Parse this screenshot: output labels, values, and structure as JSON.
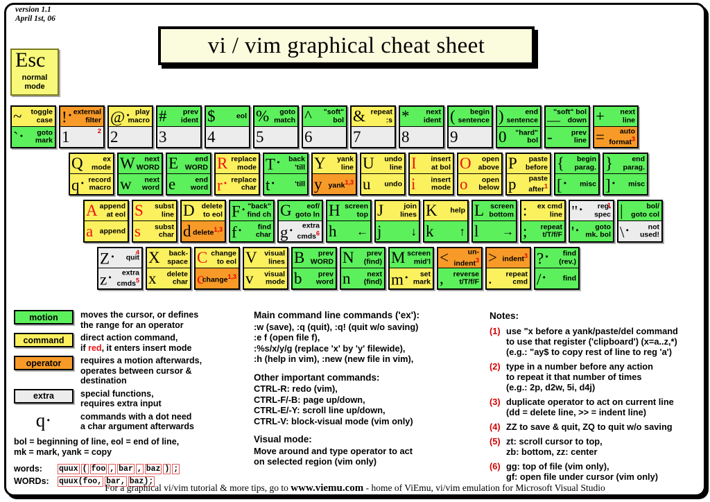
{
  "meta": {
    "version_line1": "version 1.1",
    "version_line2": "April 1st, 06",
    "title": "vi / vim graphical cheat sheet"
  },
  "esc_key": {
    "label": "Esc",
    "sub1": "normal",
    "sub2": "mode"
  },
  "colors": {
    "motion": "#5cf05c",
    "command": "#fbf05e",
    "operator": "#f79a28",
    "extra": "#ececec",
    "red_accent": "#ee1111",
    "title_bg": "#fbfbdd",
    "esc_bg": "#f8f87a"
  },
  "keyboard": {
    "rows": [
      {
        "name": "number-row",
        "indent": 15,
        "keys": [
          {
            "top": {
              "cap": "~",
              "mode": "command",
              "desc": "toggle\ncase"
            },
            "bottom": {
              "cap": "`",
              "dot": true,
              "mode": "motion",
              "desc": "goto\nmark"
            }
          },
          {
            "top": {
              "cap": "!",
              "dot": true,
              "mode": "operator",
              "desc": "external\nfilter"
            },
            "bottom": {
              "cap": "1",
              "mode": "extra",
              "desc": "",
              "sup": "2"
            }
          },
          {
            "top": {
              "cap": "@",
              "dot": true,
              "mode": "command",
              "desc": "play\nmacro"
            },
            "bottom": {
              "cap": "2",
              "mode": "extra",
              "desc": ""
            }
          },
          {
            "top": {
              "cap": "#",
              "mode": "motion",
              "desc": "prev\nident"
            },
            "bottom": {
              "cap": "3",
              "mode": "extra",
              "desc": ""
            }
          },
          {
            "top": {
              "cap": "$",
              "mode": "motion",
              "desc": "eol"
            },
            "bottom": {
              "cap": "4",
              "mode": "extra",
              "desc": ""
            }
          },
          {
            "top": {
              "cap": "%",
              "mode": "motion",
              "desc": "goto\nmatch"
            },
            "bottom": {
              "cap": "5",
              "mode": "extra",
              "desc": ""
            }
          },
          {
            "top": {
              "cap": "^",
              "mode": "motion",
              "desc": "\"soft\"\nbol"
            },
            "bottom": {
              "cap": "6",
              "mode": "extra",
              "desc": ""
            }
          },
          {
            "top": {
              "cap": "&",
              "mode": "command",
              "desc": "repeat\n:s"
            },
            "bottom": {
              "cap": "7",
              "mode": "extra",
              "desc": ""
            }
          },
          {
            "top": {
              "cap": "*",
              "mode": "motion",
              "desc": "next\nident"
            },
            "bottom": {
              "cap": "8",
              "mode": "extra",
              "desc": ""
            }
          },
          {
            "top": {
              "cap": "(",
              "mode": "motion",
              "desc": "begin\nsentence"
            },
            "bottom": {
              "cap": "9",
              "mode": "extra",
              "desc": ""
            }
          },
          {
            "top": {
              "cap": ")",
              "mode": "motion",
              "desc": "end\nsentence"
            },
            "bottom": {
              "cap": "0",
              "mode": "motion",
              "desc": "\"hard\"\nbol"
            }
          },
          {
            "top": {
              "cap": "__",
              "mode": "motion",
              "desc": "\"soft\" bol\ndown",
              "capsmall": true
            },
            "bottom": {
              "cap": "-",
              "mode": "motion",
              "desc": "prev\nline"
            }
          },
          {
            "top": {
              "cap": "+",
              "mode": "motion",
              "desc": "next\nline"
            },
            "bottom": {
              "cap": "=",
              "mode": "operator",
              "desc": "auto\nformat",
              "supin": "3"
            }
          }
        ]
      },
      {
        "name": "q-row",
        "indent": 99,
        "keys": [
          {
            "top": {
              "cap": "Q",
              "mode": "command",
              "desc": "ex\nmode"
            },
            "bottom": {
              "cap": "q",
              "dot": true,
              "mode": "command",
              "desc": "record\nmacro"
            }
          },
          {
            "top": {
              "cap": "W",
              "mode": "motion",
              "desc": "next\nWORD"
            },
            "bottom": {
              "cap": "w",
              "mode": "motion",
              "desc": "next\nword"
            }
          },
          {
            "top": {
              "cap": "E",
              "mode": "motion",
              "desc": "end\nWORD"
            },
            "bottom": {
              "cap": "e",
              "mode": "motion",
              "desc": "end\nword"
            }
          },
          {
            "top": {
              "cap": "R",
              "mode": "command",
              "red": true,
              "desc": "replace\nmode"
            },
            "bottom": {
              "cap": "r",
              "dot": true,
              "mode": "command",
              "red": true,
              "desc": "replace\nchar"
            }
          },
          {
            "top": {
              "cap": "T",
              "dot": true,
              "mode": "motion",
              "desc": "back\n'till"
            },
            "bottom": {
              "cap": "t",
              "dot": true,
              "mode": "motion",
              "desc": "'till"
            }
          },
          {
            "top": {
              "cap": "Y",
              "mode": "command",
              "desc": "yank\nline"
            },
            "bottom": {
              "cap": "y",
              "mode": "operator",
              "desc": "yank",
              "supin": "1,3"
            }
          },
          {
            "top": {
              "cap": "U",
              "mode": "command",
              "desc": "undo\nline"
            },
            "bottom": {
              "cap": "u",
              "mode": "command",
              "desc": "undo"
            }
          },
          {
            "top": {
              "cap": "I",
              "mode": "command",
              "red": true,
              "desc": "insert\nat bol"
            },
            "bottom": {
              "cap": "i",
              "mode": "command",
              "red": true,
              "desc": "insert\nmode"
            }
          },
          {
            "top": {
              "cap": "O",
              "mode": "command",
              "red": true,
              "desc": "open\nabove"
            },
            "bottom": {
              "cap": "o",
              "mode": "command",
              "red": true,
              "desc": "open\nbelow"
            }
          },
          {
            "top": {
              "cap": "P",
              "mode": "command",
              "desc": "paste\nbefore"
            },
            "bottom": {
              "cap": "p",
              "mode": "command",
              "desc": "paste\nafter",
              "supin": "1"
            }
          },
          {
            "top": {
              "cap": "{",
              "mode": "motion",
              "desc": "begin\nparag."
            },
            "bottom": {
              "cap": "[",
              "dot": true,
              "mode": "motion",
              "desc": "misc"
            }
          },
          {
            "top": {
              "cap": "}",
              "mode": "motion",
              "desc": "end\nparag."
            },
            "bottom": {
              "cap": "]",
              "dot": true,
              "mode": "motion",
              "desc": "misc"
            }
          }
        ]
      },
      {
        "name": "a-row",
        "indent": 120,
        "keys": [
          {
            "top": {
              "cap": "A",
              "mode": "command",
              "red": true,
              "desc": "append\nat eol"
            },
            "bottom": {
              "cap": "a",
              "mode": "command",
              "red": true,
              "desc": "append"
            }
          },
          {
            "top": {
              "cap": "S",
              "mode": "command",
              "red": true,
              "desc": "subst\nline"
            },
            "bottom": {
              "cap": "s",
              "mode": "command",
              "red": true,
              "desc": "subst\nchar"
            }
          },
          {
            "top": {
              "cap": "D",
              "mode": "command",
              "desc": "delete\nto eol"
            },
            "bottom": {
              "cap": "d",
              "mode": "operator",
              "desc": "delete",
              "supin": "1,3"
            }
          },
          {
            "top": {
              "cap": "F",
              "dot": true,
              "mode": "motion",
              "desc": "\"back\"\nfind ch"
            },
            "bottom": {
              "cap": "f",
              "dot": true,
              "mode": "motion",
              "desc": "find\nchar"
            }
          },
          {
            "top": {
              "cap": "G",
              "mode": "motion",
              "desc": "eof/\ngoto ln"
            },
            "bottom": {
              "cap": "g",
              "dot": true,
              "mode": "extra",
              "desc": "extra\ncmds",
              "supin": "6"
            }
          },
          {
            "top": {
              "cap": "H",
              "mode": "motion",
              "desc": "screen\ntop"
            },
            "bottom": {
              "cap": "h",
              "mode": "motion",
              "desc": "←",
              "arrow": true
            }
          },
          {
            "top": {
              "cap": "J",
              "mode": "command",
              "desc": "join\nlines"
            },
            "bottom": {
              "cap": "j",
              "mode": "motion",
              "desc": "↓",
              "arrow": true
            }
          },
          {
            "top": {
              "cap": "K",
              "mode": "command",
              "desc": "help"
            },
            "bottom": {
              "cap": "k",
              "mode": "motion",
              "desc": "↑",
              "arrow": true
            }
          },
          {
            "top": {
              "cap": "L",
              "mode": "motion",
              "desc": "screen\nbottom"
            },
            "bottom": {
              "cap": "l",
              "mode": "motion",
              "desc": "→",
              "arrow": true
            }
          },
          {
            "top": {
              "cap": ":",
              "mode": "command",
              "desc": "ex cmd\nline"
            },
            "bottom": {
              "cap": ";",
              "mode": "motion",
              "desc": "repeat\nt/T/f/F"
            }
          },
          {
            "top": {
              "cap": "\"",
              "dot": true,
              "mode": "extra",
              "desc": "reg.\nspec",
              "sup": "1"
            },
            "bottom": {
              "cap": "'",
              "dot": true,
              "mode": "motion",
              "desc": "goto\nmk. bol"
            }
          },
          {
            "top": {
              "cap": "|",
              "mode": "motion",
              "desc": "bol/\ngoto col"
            },
            "bottom": {
              "cap": "\\",
              "dot": true,
              "mode": "extra",
              "desc": "not\nused!"
            }
          }
        ]
      },
      {
        "name": "z-row",
        "indent": 140,
        "keys": [
          {
            "top": {
              "cap": "Z",
              "dot": true,
              "mode": "extra",
              "desc": "quit",
              "sup": "4"
            },
            "bottom": {
              "cap": "z",
              "dot": true,
              "mode": "extra",
              "desc": "extra\ncmds",
              "supin": "5"
            }
          },
          {
            "top": {
              "cap": "X",
              "mode": "command",
              "desc": "back-\nspace"
            },
            "bottom": {
              "cap": "x",
              "mode": "command",
              "desc": "delete\nchar"
            }
          },
          {
            "top": {
              "cap": "C",
              "mode": "command",
              "red": true,
              "desc": "change\nto eol"
            },
            "bottom": {
              "cap": "c",
              "mode": "operator",
              "red": true,
              "desc": "change",
              "supin": "1,3"
            }
          },
          {
            "top": {
              "cap": "V",
              "mode": "command",
              "desc": "visual\nlines"
            },
            "bottom": {
              "cap": "v",
              "mode": "command",
              "desc": "visual\nmode"
            }
          },
          {
            "top": {
              "cap": "B",
              "mode": "motion",
              "desc": "prev\nWORD"
            },
            "bottom": {
              "cap": "b",
              "mode": "motion",
              "desc": "prev\nword"
            }
          },
          {
            "top": {
              "cap": "N",
              "mode": "motion",
              "desc": "prev\n(find)"
            },
            "bottom": {
              "cap": "n",
              "mode": "motion",
              "desc": "next\n(find)"
            }
          },
          {
            "top": {
              "cap": "M",
              "mode": "motion",
              "desc": "screen\nmid'l"
            },
            "bottom": {
              "cap": "m",
              "dot": true,
              "mode": "command",
              "desc": "set\nmark"
            }
          },
          {
            "top": {
              "cap": "<",
              "mode": "operator",
              "desc": "un-\nindent",
              "supin": "3"
            },
            "bottom": {
              "cap": ",",
              "mode": "motion",
              "desc": "reverse\nt/T/f/F"
            }
          },
          {
            "top": {
              "cap": ">",
              "mode": "operator",
              "desc": "indent",
              "supin": "3"
            },
            "bottom": {
              "cap": ".",
              "mode": "command",
              "desc": "repeat\ncmd"
            }
          },
          {
            "top": {
              "cap": "?",
              "dot": true,
              "mode": "motion",
              "desc": "find\n(rev.)"
            },
            "bottom": {
              "cap": "/",
              "dot": true,
              "mode": "motion",
              "desc": "find"
            }
          }
        ]
      }
    ]
  },
  "legend": {
    "entries": [
      {
        "box": "motion",
        "mode": "motion",
        "text": "moves the cursor, or defines\nthe range for an operator"
      },
      {
        "box": "command",
        "mode": "command",
        "text": "direct action command,\nif red, it enters insert mode",
        "red_word": "red"
      },
      {
        "box": "operator",
        "mode": "operator",
        "text": "requires a motion afterwards,\noperates between cursor  &\ndestination"
      },
      {
        "box": "extra",
        "mode": "extra",
        "text": "special functions,\nrequires extra input"
      }
    ],
    "dot_symbol": "q·",
    "dot_text": "commands with a dot need\na char argument afterwards",
    "abbrev": "bol = beginning of line, eol = end of line,\nmk = mark, yank = copy",
    "words_label": "words:",
    "words_tokens": [
      "quux",
      "(",
      "foo",
      ",",
      "bar",
      ",",
      "baz",
      ")",
      ";"
    ],
    "WORDS_label": "WORDs:",
    "WORDS_tokens": [
      "quux(foo,",
      "bar,",
      "baz);"
    ]
  },
  "middle": {
    "heading1": "Main command line commands ('ex'):",
    "lines1": [
      ":w (save), :q (quit), :q! (quit w/o saving)",
      ":e f (open file f),",
      ":%s/x/y/g (replace 'x' by 'y' filewide),",
      ":h (help in vim), :new (new file in vim),"
    ],
    "heading2": "Other important commands:",
    "lines2": [
      "CTRL-R: redo (vim),",
      "CTRL-F/-B: page up/down,",
      "CTRL-E/-Y: scroll line up/down,",
      "CTRL-V: block-visual mode (vim only)"
    ],
    "heading3": "Visual mode:",
    "lines3": [
      "Move around and type operator to act",
      "on selected region (vim only)"
    ]
  },
  "notes": {
    "heading": "Notes:",
    "items": [
      {
        "n": "(1)",
        "text": "use \"x before a yank/paste/del command\nto use that register ('clipboard') (x=a..z,*)\n(e.g.: \"ay$ to copy rest of line to reg 'a')"
      },
      {
        "n": "(2)",
        "text": "type in a number before any action\nto repeat it that number of times\n(e.g.: 2p, d2w, 5i, d4j)"
      },
      {
        "n": "(3)",
        "text": "duplicate operator to act on current line\n(dd = delete line, >> = indent line)"
      },
      {
        "n": "(4)",
        "text": "ZZ to save & quit, ZQ to quit w/o saving"
      },
      {
        "n": "(5)",
        "text": "zt: scroll cursor to top,\nzb: bottom, zz: center"
      },
      {
        "n": "(6)",
        "text": "gg: top of file (vim only),\ngf: open file under cursor (vim only)"
      }
    ]
  },
  "footer": {
    "pre": "For a graphical vi/vim tutorial & more tips, go to",
    "url": "www.viemu.com",
    "post": "- home of ViEmu, vi/vim emulation for Microsoft Visual Studio"
  }
}
